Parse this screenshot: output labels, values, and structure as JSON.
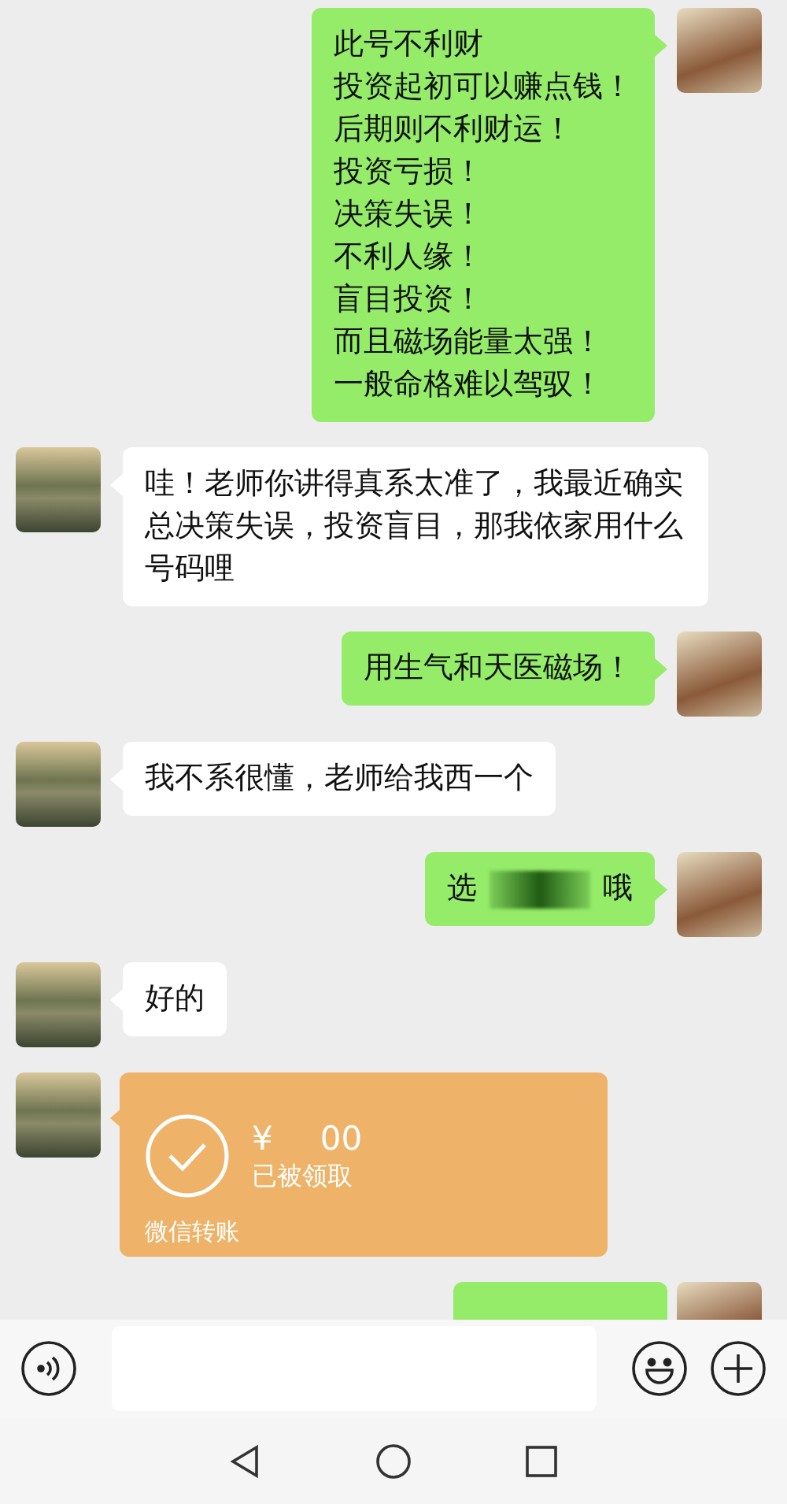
{
  "messages": [
    {
      "outgoing": true,
      "kind": "text",
      "lines": [
        "此号不利财",
        "投资起初可以赚点钱！",
        "后期则不利财运！",
        "投资亏损！",
        "决策失误！",
        "不利人缘！",
        "盲目投资！",
        "而且磁场能量太强！",
        "一般命格难以驾驭！"
      ]
    },
    {
      "outgoing": false,
      "kind": "text",
      "lines": [
        "哇！老师你讲得真系太准了，我最近确实总决策失误，投资盲目，那我依家用什么号码哩"
      ]
    },
    {
      "outgoing": true,
      "kind": "text",
      "lines": [
        "用生气和天医磁场！"
      ]
    },
    {
      "outgoing": false,
      "kind": "text",
      "lines": [
        "我不系很懂，老师给我西一个"
      ]
    },
    {
      "outgoing": true,
      "kind": "redacted",
      "before": "选",
      "after": "哦"
    },
    {
      "outgoing": false,
      "kind": "text",
      "lines": [
        "好的"
      ]
    },
    {
      "outgoing": false,
      "kind": "transfer",
      "amount_prefix": "¥",
      "amount_suffix": "00",
      "status": "已被领取",
      "footer": "微信转账"
    },
    {
      "outgoing": true,
      "kind": "partial"
    }
  ]
}
